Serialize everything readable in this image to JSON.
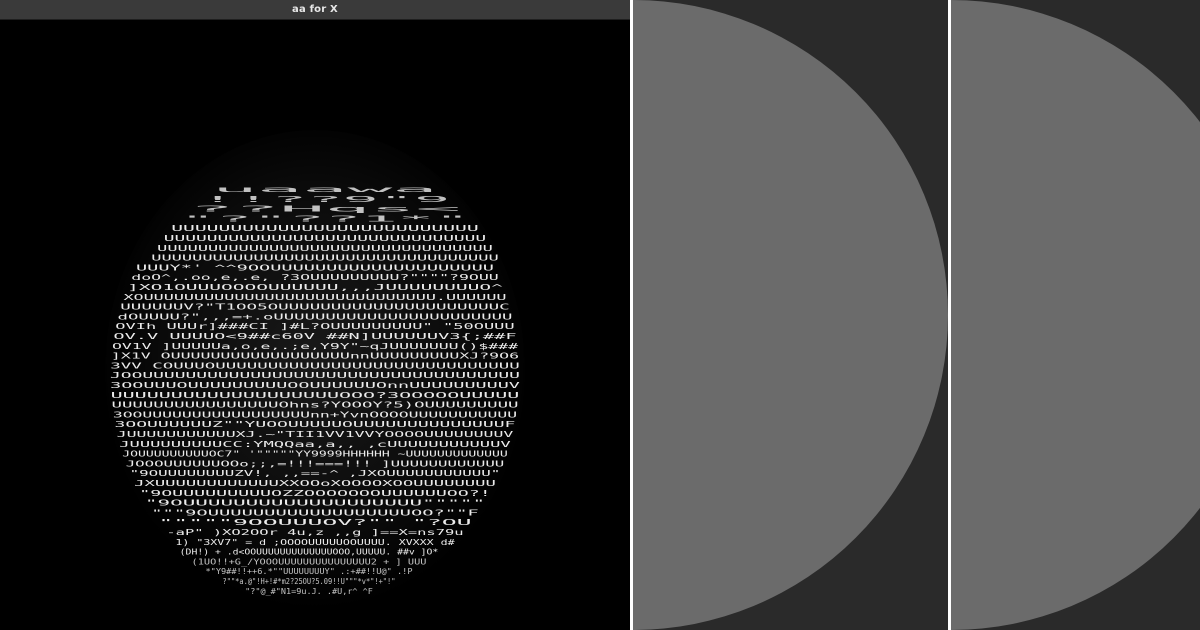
{
  "window": {
    "title": "aa for X"
  },
  "colors": {
    "titlebar_bg": "#3a3a3a",
    "titlebar_text": "#e8e8e8",
    "canvas_bg": "#000000",
    "panel_bg": "#2a2a2a",
    "panel_circle": "#6b6b6b",
    "divider": "#ffffff"
  },
  "ascii_art": {
    "subject": "portrait-face",
    "text_color": "#ffffff",
    "fragments": [
      "uaawa",
      "!!??9\"9",
      "??Hqs<",
      "\"?\"??1*\"",
      "UUUUUUUUUUUUUUUUUUUUUUUUUU",
      "UUUUUUUUUUUUUUUUUUUUUUUUUUUUUU",
      "UUUUUUUUUUUUUUUUUUUUUUUUUUUUUUUUU",
      "UUUUUUUUUUUUUUUUUUUUUUUUUUUUUUUUUU",
      "UUUY*'  ^^9OOUUUUUUUUUUUUUUUUUUUU",
      "doO^,.oo,e,.e, ?3OUUUUUUUUU?\"\"\"\"?9OUU",
      "]XO1OUUUOOOOUUUUUU,,,JUUUUUUUUO^",
      "XOUUUUUUUUUUUUUUUUUUUUUUUUUUUUU.UUUUUU",
      "UUUUUUV?\"T1OO5OUUUUUUUUUUUUUUUUUUUUUC",
      "dOUUUU?\",,,=+.oUUUUUUUUUUUUUUUUUUUUUUU",
      "OVIh  UUUr]###CI  ]#L?OUUUUUUUUU\"  \"50OUUU",
      "OV.V  UUUUO<9##c60V ##N]UUUUUUV3{;##F",
      "OV1V  ]UUUUUa,o,e,.;e,Y9Y\"~qJUUUUUUU()$###",
      "]X1V  OUUUUUUUUUUUUUUUUUUnnUUUUUUUUUXJ?9O6",
      "3VV  COUUUOUUUUUUUUUUUUUUUUUUUUUUUUUUUUU",
      "JOOUUUUUUUUUUUUUUUUUUUUUUUUUUUUUUUUUUU",
      "3OOUUUOUUUUUUUUUOOUUUUUUOnnUUUUUUUUUV",
      "UUUUUUUUUUUUUUUUUUUOOO?3OOOOOUUUUU",
      "UUUUUUUUUUUUUUUUOhns?YOOOY?5)OUUUUUUUUU",
      "3OOUUUUUUUUUUUUUUUUUnn+YvnOOOOUUUUUUUUUUU",
      "3OOUUUUUUZ\"\"YUOOUUUUUOUUUUUUUUUUUUUUF",
      "JUUUUUUUUUUUXJ.~\"TII1VV1VVYOOOOUUUUUUUUV",
      "JUUUUUUUUUCC:YMQQaa,a,,  ,cUUUUUUUUUUUV",
      "JOUUUUUUUUUOC7\" '\"\"\"\"\"YY9999HHHHHH  ~UUUUUUUUUUUUU",
      "JOOOUUUUUUOOo;;,=!!!===!!!  ]UUUUUUUUUUUU",
      "\"9OUUUUUUUUZV!, ,,==-^  ,JXOUUUUUUUUUUU\"",
      "JXUUUUUUUUUUUUXXOOoXOOOOXOOUUUUUUUU",
      "\"9OUUUUUUUUUOZZOOOOOOOUUUUUUOO?!",
      "\"9OUUUUUUUUUUUUUUUUUUU\"\"\"\"\"",
      "\"\"\"9OUUUUUUUUUUUUUUUUUUOO?\"\"F",
      "\"\"\"\"\"9OOUUUOV?\"\"  \"?OU",
      "-aP\"  )XO2OOr  4u,z         ,,g  ]==X=ns79u",
      "1)    \"3XV7\"  =   d  ;OOOOUUUUUOOUUUU.  XVXXX  d#",
      "(DH!)  +  .d<OOUUUUUUUUUUUUUOOO,UUUUU.  ##v  ]O*",
      "(1UO!!+G_/YOOOUUUUUUUUUUUUUUU2  +  ]  UUU",
      "*\"Y9##!!++6.*\"\"UUUUUUUUY\"  .:+##!!U@\"  .!P",
      "?\"\"*a.@\"!H+!#*m2?25OU?5.09!!U\"\"\"*v*\"!+\"!\"",
      "\"?\"@_#\"N1=9u.J.  .#U,r^ ^F"
    ]
  },
  "right_panels": [
    {
      "label": ""
    },
    {
      "label": ""
    }
  ]
}
